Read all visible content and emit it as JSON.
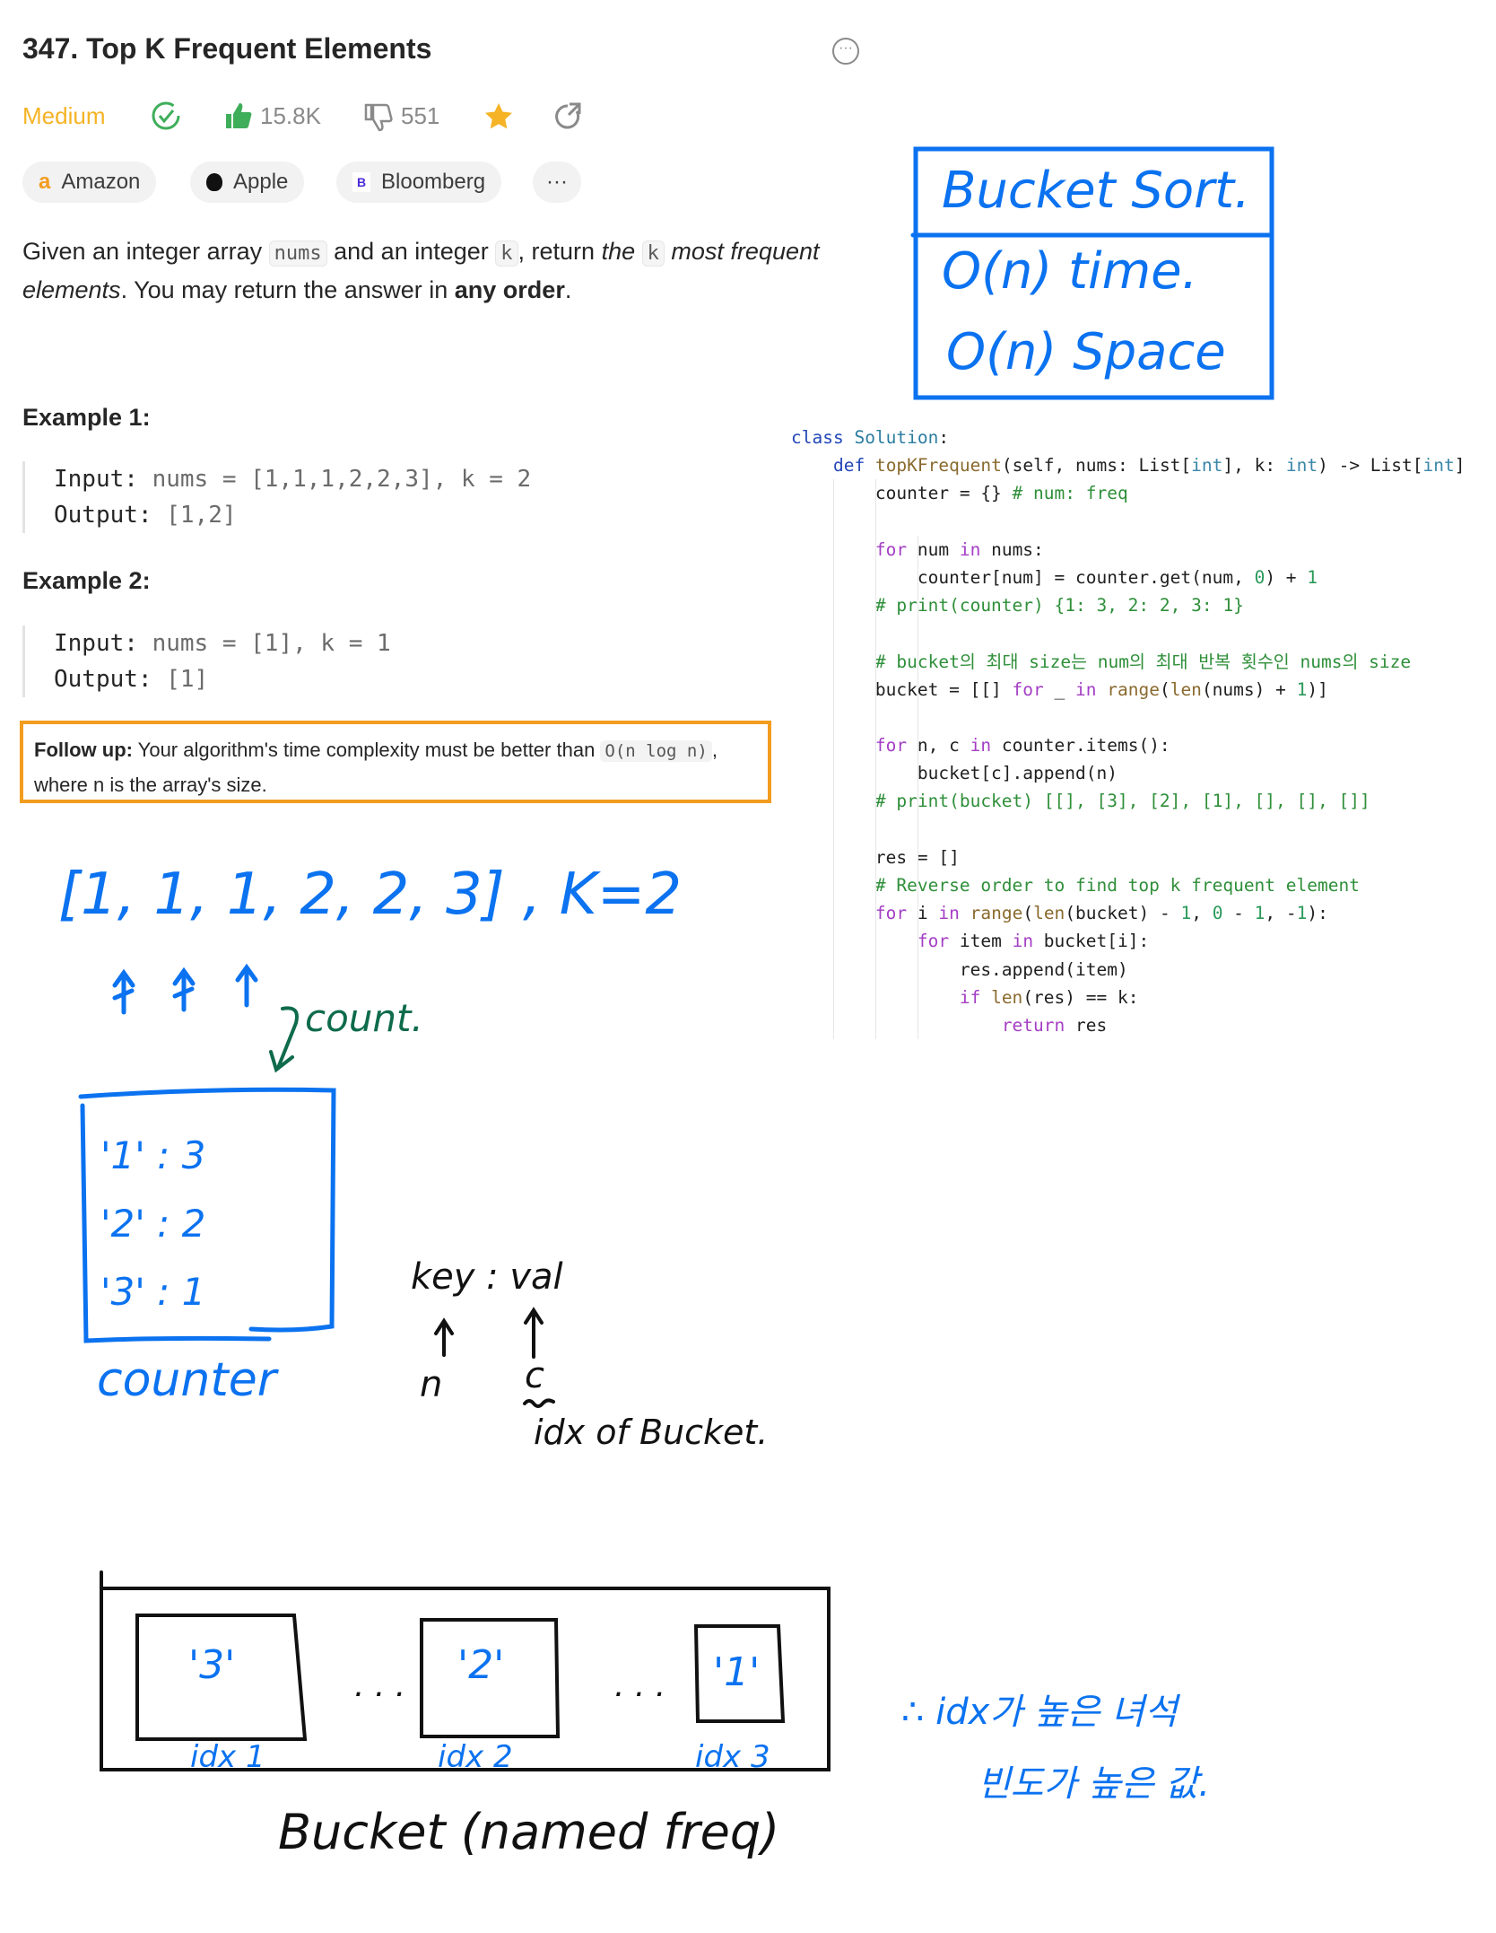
{
  "problem": {
    "title": "347. Top K Frequent Elements",
    "difficulty": "Medium",
    "likes": "15.8K",
    "dislikes": "551",
    "tags": [
      "Amazon",
      "Apple",
      "Bloomberg"
    ],
    "more_tags": "···",
    "desc": {
      "p1": "Given an integer array ",
      "c1": "nums",
      "p2": " and an integer ",
      "c2": "k",
      "p3": ", return ",
      "i1": "the",
      "c3": "k",
      "i2": "most frequent elements",
      "p4": ". You may return the answer in ",
      "b1": "any order",
      "p5": "."
    },
    "examples": [
      {
        "heading": "Example 1:",
        "input_label": "Input:",
        "input": " nums = [1,1,1,2,2,3], k = 2",
        "output_label": "Output:",
        "output": " [1,2]"
      },
      {
        "heading": "Example 2:",
        "input_label": "Input:",
        "input": " nums = [1], k = 1",
        "output_label": "Output:",
        "output": " [1]"
      }
    ],
    "follow_up": {
      "label": "Follow up:",
      "text": " Your algorithm's time complexity must be better than ",
      "code": "O(n log n)",
      "tail": ", where n is the array's size."
    }
  },
  "code_lines": [
    "class Solution:",
    "    def topKFrequent(self, nums: List[int], k: int) -> List[int]",
    "        counter = {} # num: freq",
    "",
    "        for num in nums:",
    "            counter[num] = counter.get(num, 0) + 1",
    "        # print(counter) {1: 3, 2: 2, 3: 1}",
    "",
    "        # bucket의 최대 size는 num의 최대 반복 횟수인 nums의 size",
    "        bucket = [[] for _ in range(len(nums) + 1)]",
    "",
    "        for n, c in counter.items():",
    "            bucket[c].append(n)",
    "        # print(bucket) [[], [3], [2], [1], [], [], []]",
    "",
    "        res = []",
    "        # Reverse order to find top k frequent element",
    "        for i in range(len(bucket) - 1, 0 - 1, -1):",
    "            for item in bucket[i]:",
    "                res.append(item)",
    "                if len(res) == k:",
    "                    return res"
  ],
  "notes": {
    "box": [
      "Bucket Sort.",
      "O(n) time.",
      "O(n) Space"
    ],
    "array": "[1, 1, 1, 2, 2, 3] , K=2",
    "count": "count.",
    "counter_rows": [
      "'1' : 3",
      "'2' : 2",
      "'3' : 1"
    ],
    "counter_label": "counter",
    "keyval": "key : val",
    "n": "n",
    "c": "c",
    "idx_of_bucket": "idx of Bucket.",
    "bucket_items": [
      "'3'",
      "'2'",
      "'1'"
    ],
    "bucket_idx": [
      "idx 1",
      "idx 2",
      "idx 3"
    ],
    "bucket_label": "Bucket (named freq)",
    "conclusion": [
      "∴ idx가 높은 녀석",
      "빈도가 높은 값."
    ]
  },
  "colors": {
    "accent_orange": "#f39c1f",
    "difficulty": "#f5b325",
    "ink_blue": "#0b72f0",
    "ink_green": "#0e6b4c",
    "ink_black": "#111111"
  }
}
